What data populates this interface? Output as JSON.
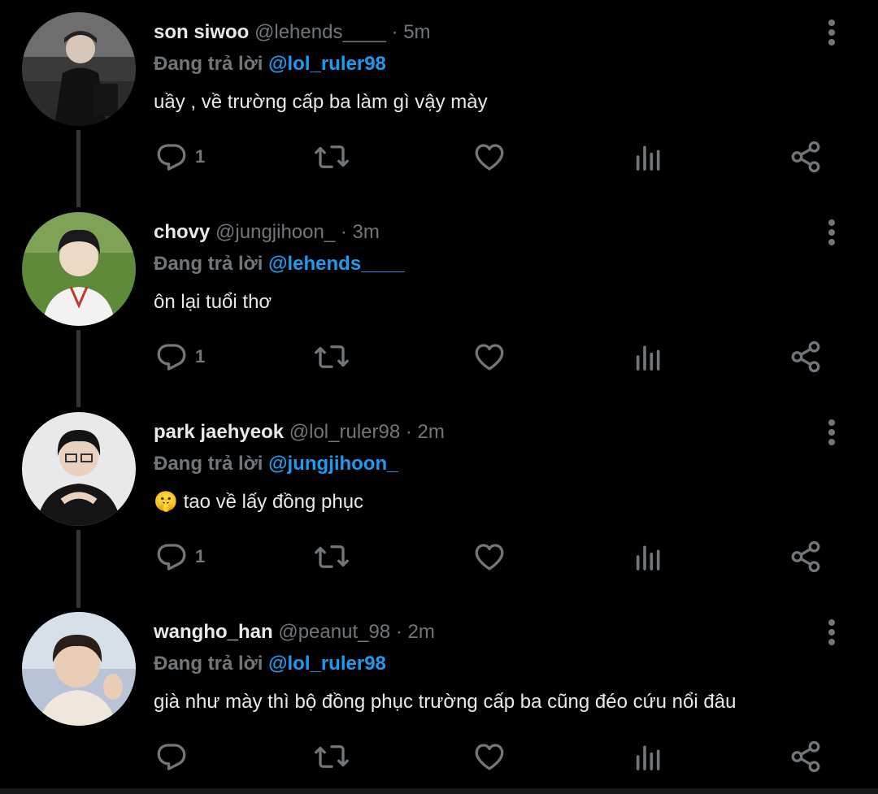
{
  "colors": {
    "background": "#000000",
    "text": "#e7e9ea",
    "muted": "#71767b",
    "accent": "#1d9bf0",
    "thread_line": "#333639"
  },
  "tweets": [
    {
      "name": "son siwoo",
      "handle": "@lehends____",
      "dot": "·",
      "time": "5m",
      "replying_prefix": "Đang trả lời",
      "replying_to": "@lol_ruler98",
      "text": "uầy , về trường cấp ba làm gì vậy mày",
      "emoji": "",
      "reply_count": "1",
      "avatar_icon": "avatar-photo"
    },
    {
      "name": "chovy",
      "handle": "@jungjihoon_",
      "dot": "·",
      "time": "3m",
      "replying_prefix": "Đang trả lời",
      "replying_to": "@lehends____",
      "text": "ôn lại tuổi thơ",
      "emoji": "",
      "reply_count": "1",
      "avatar_icon": "avatar-photo"
    },
    {
      "name": "park jaehyeok",
      "handle": "@lol_ruler98",
      "dot": "·",
      "time": "2m",
      "replying_prefix": "Đang trả lời",
      "replying_to": "@jungjihoon_",
      "text": "tao về lấy đồng phục",
      "emoji": "🤫",
      "reply_count": "1",
      "avatar_icon": "avatar-photo"
    },
    {
      "name": "wangho_han",
      "handle": "@peanut_98",
      "dot": "·",
      "time": "2m",
      "replying_prefix": "Đang trả lời",
      "replying_to": "@lol_ruler98",
      "text": "già như mày thì bộ đồng phục trường cấp ba cũng đéo cứu nổi đâu",
      "emoji": "",
      "reply_count": "",
      "avatar_icon": "avatar-photo"
    }
  ],
  "action_icons": [
    "reply-icon",
    "retweet-icon",
    "like-icon",
    "analytics-icon",
    "share-icon"
  ]
}
